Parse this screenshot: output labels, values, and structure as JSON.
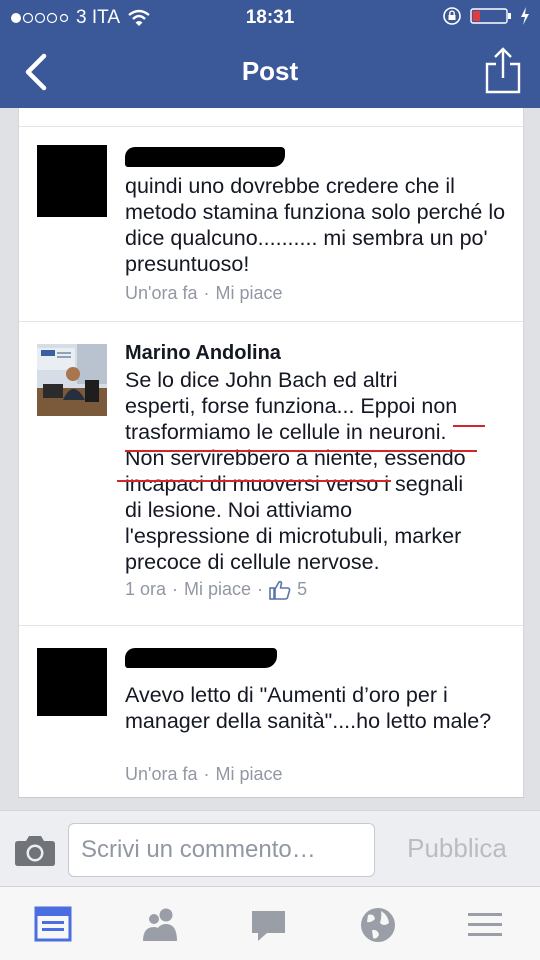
{
  "status_bar": {
    "carrier": "3 ITA",
    "time": "18:31"
  },
  "nav": {
    "title": "Post",
    "back_icon": "chevron-left-icon",
    "share_icon": "share-icon"
  },
  "comments": [
    {
      "author": "",
      "author_redacted": true,
      "text": "quindi uno dovrebbe credere che il metodo stamina funziona solo perché lo dice qualcuno.......... mi sembra un po' presuntuoso!",
      "time": "Un'ora fa",
      "like_action": "Mi piace"
    },
    {
      "author": "Marino Andolina",
      "author_redacted": false,
      "text_lines": [
        "Se lo dice John Bach ed altri",
        "esperti, forse funziona... Eppoi non",
        "trasformiamo le cellule in neuroni.",
        "Non servirebbero a niente, essendo",
        "incapaci di muoversi verso i segnali",
        "di lesione. Noi attiviamo",
        "l'espressione di microtubuli, marker",
        "precoce di cellule nervose."
      ],
      "time": "1 ora",
      "like_action": "Mi piace",
      "like_count": "5"
    },
    {
      "author": "",
      "author_redacted": true,
      "text": "Avevo letto di \"Aumenti d’oro per i manager della sanità\"....ho letto male?",
      "time": "Un'ora fa",
      "like_action": "Mi piace"
    }
  ],
  "composer": {
    "placeholder": "Scrivi un commento…",
    "publish_label": "Pubblica"
  },
  "colors": {
    "brand": "#3b5998",
    "underline": "#d4262a",
    "muted": "#9197a3"
  },
  "tabs": [
    {
      "icon": "news-feed-icon",
      "active": true
    },
    {
      "icon": "friends-icon",
      "active": false
    },
    {
      "icon": "messages-icon",
      "active": false
    },
    {
      "icon": "globe-icon",
      "active": false
    },
    {
      "icon": "menu-icon",
      "active": false
    }
  ]
}
